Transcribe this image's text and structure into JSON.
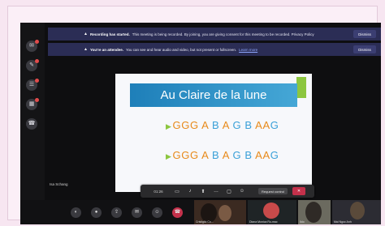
{
  "banners": {
    "recording": {
      "strong": "Recording has started.",
      "text": "This meeting is being recorded. By joining, you are giving consent for this meeting to be recorded. Privacy Policy",
      "dismiss": "Dismiss"
    },
    "attendee": {
      "strong": "You're an attendee.",
      "text": "You can see and hear audio and video, but not present or fullscreen.",
      "link": "Learn more",
      "dismiss": "Dismiss"
    }
  },
  "slide": {
    "title": "Au Claire de la lune",
    "line1": [
      {
        "t": "GGG ",
        "c": "o"
      },
      {
        "t": "A ",
        "c": "o"
      },
      {
        "t": "B ",
        "c": "b"
      },
      {
        "t": "A ",
        "c": "o"
      },
      {
        "t": "G ",
        "c": "b"
      },
      {
        "t": "B ",
        "c": "b"
      },
      {
        "t": "AA",
        "c": "o"
      },
      {
        "t": "G",
        "c": "b"
      }
    ],
    "line2": [
      {
        "t": "GGG ",
        "c": "o"
      },
      {
        "t": "A ",
        "c": "o"
      },
      {
        "t": "B ",
        "c": "b"
      },
      {
        "t": "A ",
        "c": "o"
      },
      {
        "t": "G ",
        "c": "b"
      },
      {
        "t": "B ",
        "c": "b"
      },
      {
        "t": "AA",
        "c": "o"
      },
      {
        "t": "G",
        "c": "b"
      }
    ]
  },
  "presenter": {
    "label": "Isa Schang"
  },
  "share_toolbar": {
    "timer": "01:26",
    "control_label": "Request control",
    "icons": [
      "camera-icon",
      "mic-icon",
      "share-icon",
      "more-icon",
      "chat-icon",
      "people-icon"
    ]
  },
  "call_controls": {
    "buttons": [
      "camera-icon",
      "mic-icon",
      "share-icon",
      "chat-icon",
      "people-icon",
      "hang-up-icon"
    ]
  },
  "participants": [
    {
      "name": "Cristiglio Co...",
      "tile_color": "#3b2a21"
    },
    {
      "name": "Diana Monica Ru-mac",
      "tile_color": "#1f2426"
    },
    {
      "name": "Ildo",
      "tile_color": "#6b6a5f"
    },
    {
      "name": "Mai Ngoc Anh",
      "tile_color": "#2c2c33"
    }
  ],
  "colors": {
    "note_orange": "#e88a1a",
    "note_blue": "#3aa0d8",
    "stop_red": "#c4314b"
  }
}
